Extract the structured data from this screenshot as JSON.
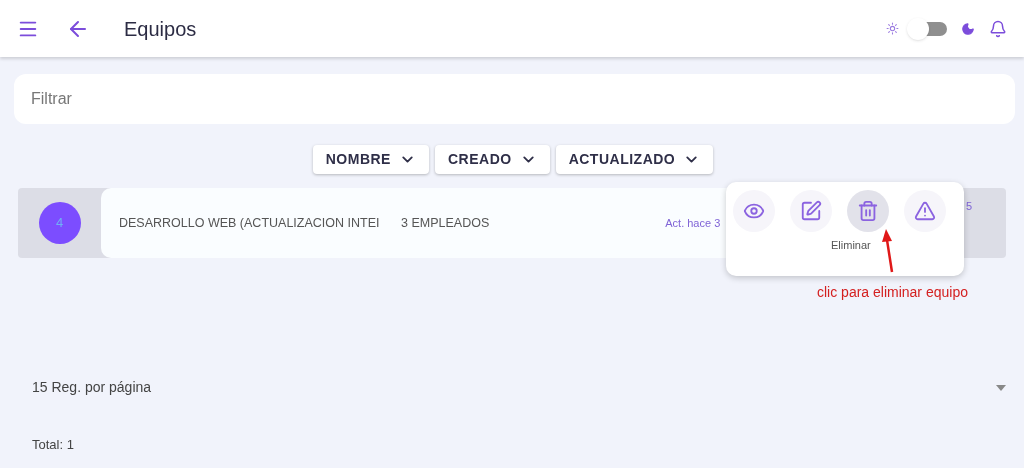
{
  "header": {
    "title": "Equipos",
    "theme_toggle": {
      "on": false
    }
  },
  "filter": {
    "placeholder": "Filtrar"
  },
  "sort_buttons": [
    "NOMBRE",
    "CREADO",
    "ACTUALIZADO"
  ],
  "rows": [
    {
      "badge": "4",
      "name": "DESARROLLO WEB (ACTUALIZACION INTEI",
      "employees": "3 EMPLEADOS",
      "updated": "Act. hace 3",
      "column_4": "5"
    }
  ],
  "actions_popup": {
    "actions": [
      {
        "kind": "view",
        "selected": false
      },
      {
        "kind": "edit",
        "selected": false
      },
      {
        "kind": "delete",
        "selected": true
      },
      {
        "kind": "warning",
        "selected": false
      }
    ],
    "tooltip": "Eliminar"
  },
  "annotation": "clic para eliminar equipo",
  "footer": {
    "per_page": "15 Reg. por página",
    "total": "Total: 1"
  }
}
